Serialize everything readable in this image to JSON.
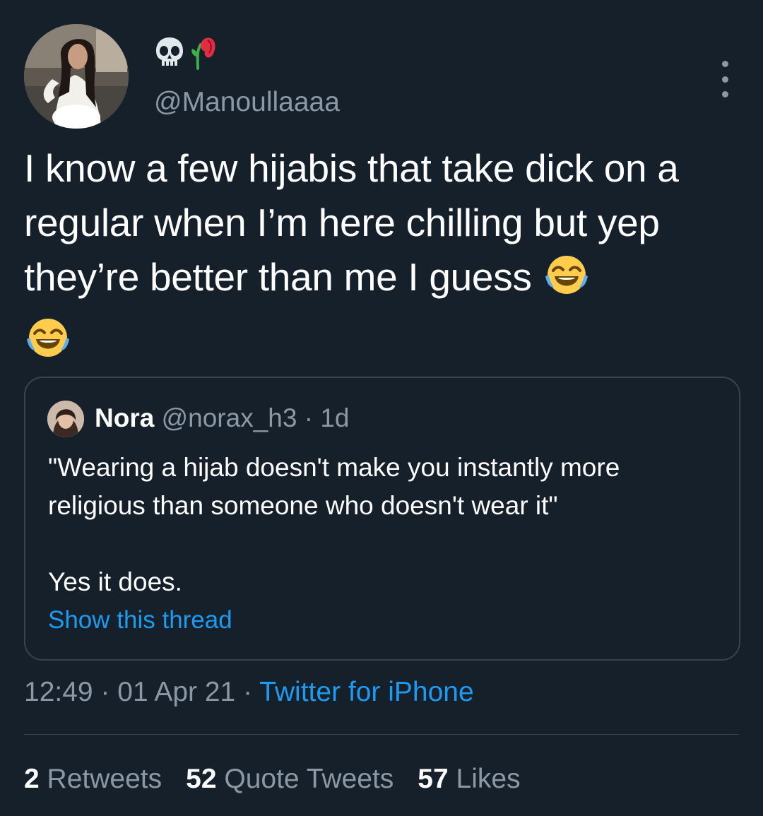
{
  "tweet": {
    "author": {
      "display_name_icons": [
        "skull-icon",
        "wilted-rose-icon"
      ],
      "handle": "@Manoullaaaa"
    },
    "text": "I know a few hijabis that take dick on a regular when I’m here chilling but yep they’re better than me I guess",
    "text_emojis": [
      "face-with-tears-of-joy-icon",
      "face-with-tears-of-joy-icon"
    ],
    "timestamp": "12:49 · 01 Apr 21",
    "separator": " · ",
    "client": "Twitter for iPhone",
    "stats": [
      {
        "count": "2",
        "label": "Retweets"
      },
      {
        "count": "52",
        "label": "Quote Tweets"
      },
      {
        "count": "57",
        "label": "Likes"
      }
    ]
  },
  "quoted_tweet": {
    "name": "Nora",
    "meta": "@norax_h3 · 1d",
    "text": "\"Wearing a hijab doesn't make you instantly more religious than someone who doesn't wear it\"\n\nYes it does.",
    "show_thread_label": "Show this thread"
  },
  "colors": {
    "background": "#15202b",
    "text": "#ffffff",
    "secondary_text": "#8b98a5",
    "link": "#1d9bf0",
    "border": "#38444d"
  }
}
